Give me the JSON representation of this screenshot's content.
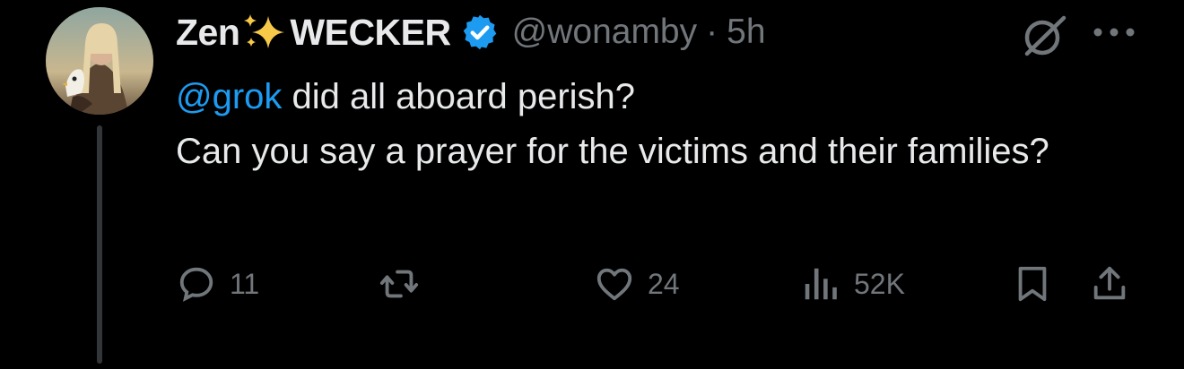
{
  "tweet": {
    "author_name_part1": "Zen",
    "author_name_part2": "WECKER",
    "handle": "@wonamby",
    "separator": "·",
    "time": "5h",
    "mention": "@grok",
    "line1_rest": " did all aboard perish?",
    "line2": "Can you say a prayer for the victims and their families?"
  },
  "actions": {
    "replies": "11",
    "likes": "24",
    "views": "52K"
  },
  "colors": {
    "background": "#000000",
    "text": "#e7e9ea",
    "muted": "#71767b",
    "accent": "#1d9bf0",
    "sparkle": "#f7c948"
  },
  "icons": [
    "avatar",
    "sparkles-icon",
    "verified-badge-icon",
    "grok-icon",
    "more-icon",
    "reply-icon",
    "retweet-icon",
    "like-icon",
    "views-icon",
    "bookmark-icon",
    "share-icon"
  ]
}
